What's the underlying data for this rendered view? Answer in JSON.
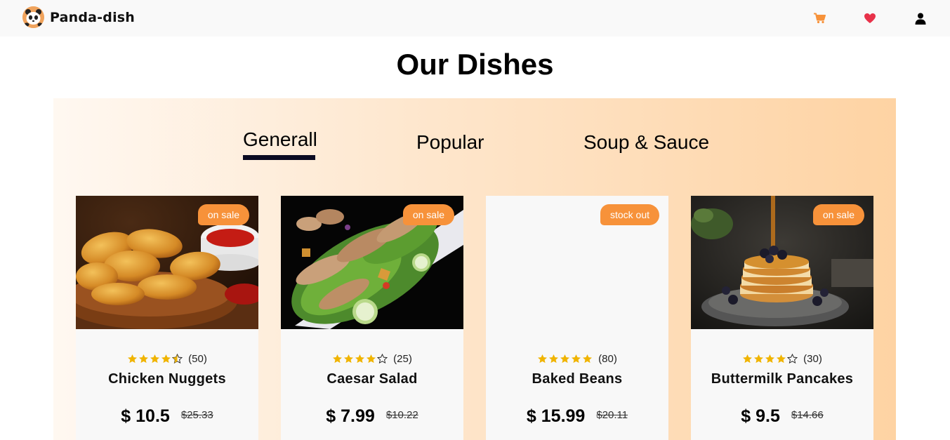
{
  "brand": {
    "name": "Panda-dish",
    "logo_icon": "panda-logo-icon"
  },
  "nav": {
    "icons": [
      {
        "name": "cart-icon",
        "color": "#f7923a"
      },
      {
        "name": "heart-icon",
        "color": "#e8324a"
      },
      {
        "name": "user-icon",
        "color": "#000000"
      }
    ]
  },
  "page": {
    "title": "Our Dishes"
  },
  "tabs": [
    {
      "label": "Generall",
      "active": true
    },
    {
      "label": "Popular",
      "active": false
    },
    {
      "label": "Soup & Sauce",
      "active": false
    }
  ],
  "colors": {
    "accent": "#f7923a",
    "star": "#f0b400",
    "tab_underline": "#0b0b22"
  },
  "dishes": [
    {
      "name": "Chicken Nuggets",
      "badge": "on sale",
      "rating": 4.5,
      "reviews": "(50)",
      "price": "$ 10.5",
      "old_price": "$25.33",
      "image": "chicken-nuggets-photo"
    },
    {
      "name": "Caesar Salad",
      "badge": "on sale",
      "rating": 4,
      "reviews": "(25)",
      "price": "$ 7.99",
      "old_price": "$10.22",
      "image": "caesar-salad-photo"
    },
    {
      "name": "Baked Beans",
      "badge": "stock out",
      "rating": 5,
      "reviews": "(80)",
      "price": "$ 15.99",
      "old_price": "$20.11",
      "image": ""
    },
    {
      "name": "Buttermilk Pancakes",
      "badge": "on sale",
      "rating": 4,
      "reviews": "(30)",
      "price": "$ 9.5",
      "old_price": "$14.66",
      "image": "pancakes-photo"
    }
  ]
}
